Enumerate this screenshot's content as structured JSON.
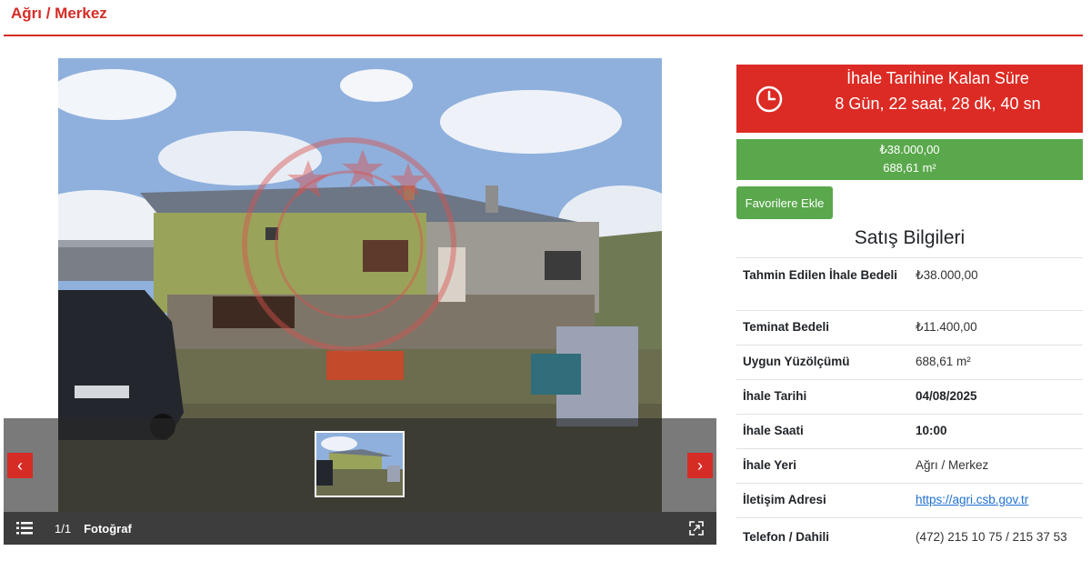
{
  "page": {
    "title": "Ağrı / Merkez"
  },
  "gallery": {
    "counter": "1/1",
    "counter_label": "Fotoğraf",
    "prev": "‹",
    "next": "›"
  },
  "countdown": {
    "title": "İhale Tarihine Kalan Süre",
    "value": "8 Gün, 22 saat, 28 dk, 40 sn"
  },
  "price": {
    "amount": "₺38.000,00",
    "area": "688,61 m²"
  },
  "actions": {
    "favorite_label": "Favorilere Ekle"
  },
  "sale_info": {
    "title": "Satış Bilgileri",
    "rows": [
      {
        "label": "Tahmin Edilen İhale Bedeli",
        "value": "₺38.000,00"
      },
      {
        "label": "Teminat Bedeli",
        "value": "₺11.400,00"
      },
      {
        "label": "Uygun Yüzölçümü",
        "value": "688,61 m²"
      },
      {
        "label": "İhale Tarihi",
        "value": "04/08/2025"
      },
      {
        "label": "İhale Saati",
        "value": "10:00"
      },
      {
        "label": "İhale Yeri",
        "value": "Ağrı / Merkez"
      },
      {
        "label": "İletişim Adresi",
        "value": "https://agri.csb.gov.tr"
      },
      {
        "label": "Telefon / Dahili",
        "value": "(472) 215 10 75 / 215 37 53"
      }
    ]
  },
  "colors": {
    "accent": "#d62c26",
    "success": "#5aa84c",
    "link": "#1f6fd1"
  }
}
